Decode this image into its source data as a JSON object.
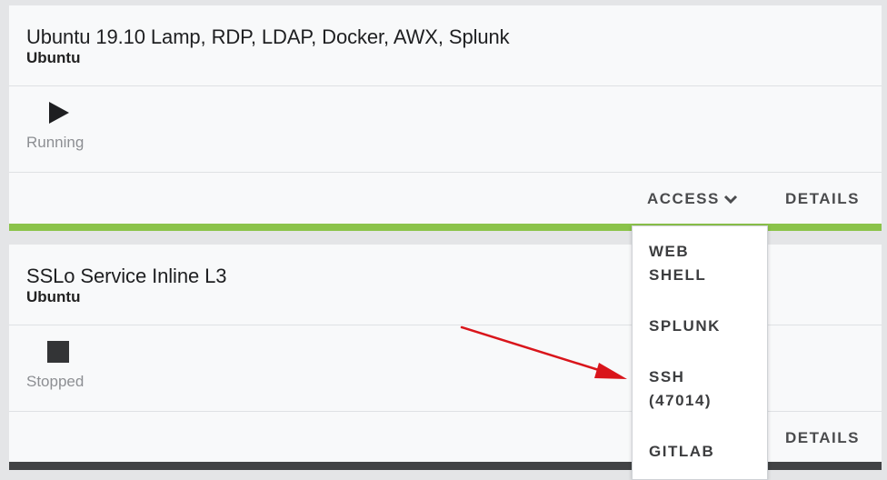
{
  "cards": [
    {
      "title": "Ubuntu 19.10 Lamp, RDP, LDAP, Docker, AWX, Splunk",
      "subtitle": "Ubuntu",
      "status": "Running",
      "status_icon": "play-icon",
      "access_label": "ACCESS",
      "details_label": "DETAILS",
      "accent_color": "#8bc34a"
    },
    {
      "title": "SSLo Service Inline L3",
      "subtitle": "Ubuntu",
      "status": "Stopped",
      "status_icon": "stop-icon",
      "details_label": "DETAILS"
    }
  ],
  "access_menu": {
    "items": [
      {
        "label": "WEB SHELL"
      },
      {
        "label": "SPLUNK"
      },
      {
        "label": "SSH (47014)"
      },
      {
        "label": "GITLAB"
      }
    ]
  },
  "annotation": {
    "arrow_color": "#d9151b",
    "arrow_icon": "red-arrow-icon"
  }
}
